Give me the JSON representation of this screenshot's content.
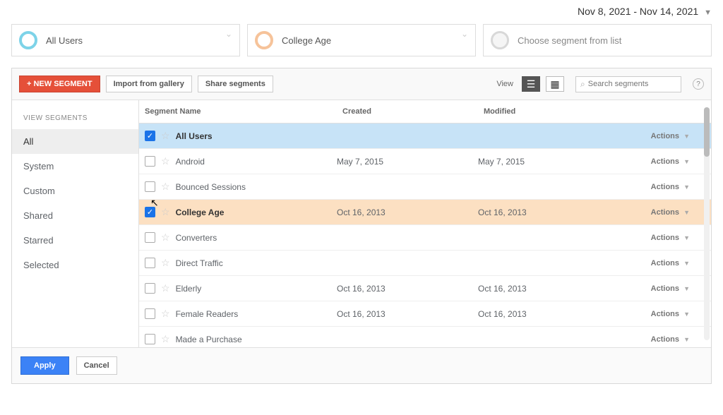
{
  "date_range": "Nov 8, 2021 - Nov 14, 2021",
  "chips": {
    "all_users": "All Users",
    "college_age": "College Age",
    "choose": "Choose segment from list"
  },
  "toolbar": {
    "new_segment": "+ NEW SEGMENT",
    "import": "Import from gallery",
    "share": "Share segments",
    "view_label": "View",
    "search_placeholder": "Search segments"
  },
  "sidebar": {
    "header": "VIEW SEGMENTS",
    "items": [
      "All",
      "System",
      "Custom",
      "Shared",
      "Starred",
      "Selected"
    ]
  },
  "table": {
    "headers": {
      "name": "Segment Name",
      "created": "Created",
      "modified": "Modified"
    },
    "actions_label": "Actions",
    "rows": [
      {
        "name": "All Users",
        "created": "",
        "modified": "",
        "checked": true,
        "bold": true,
        "highlight": "blue"
      },
      {
        "name": "Android",
        "created": "May 7, 2015",
        "modified": "May 7, 2015",
        "checked": false,
        "bold": false,
        "highlight": ""
      },
      {
        "name": "Bounced Sessions",
        "created": "",
        "modified": "",
        "checked": false,
        "bold": false,
        "highlight": ""
      },
      {
        "name": "College Age",
        "created": "Oct 16, 2013",
        "modified": "Oct 16, 2013",
        "checked": true,
        "bold": true,
        "highlight": "orange"
      },
      {
        "name": "Converters",
        "created": "",
        "modified": "",
        "checked": false,
        "bold": false,
        "highlight": ""
      },
      {
        "name": "Direct Traffic",
        "created": "",
        "modified": "",
        "checked": false,
        "bold": false,
        "highlight": ""
      },
      {
        "name": "Elderly",
        "created": "Oct 16, 2013",
        "modified": "Oct 16, 2013",
        "checked": false,
        "bold": false,
        "highlight": ""
      },
      {
        "name": "Female Readers",
        "created": "Oct 16, 2013",
        "modified": "Oct 16, 2013",
        "checked": false,
        "bold": false,
        "highlight": ""
      },
      {
        "name": "Made a Purchase",
        "created": "",
        "modified": "",
        "checked": false,
        "bold": false,
        "highlight": ""
      }
    ]
  },
  "footer": {
    "apply": "Apply",
    "cancel": "Cancel"
  }
}
